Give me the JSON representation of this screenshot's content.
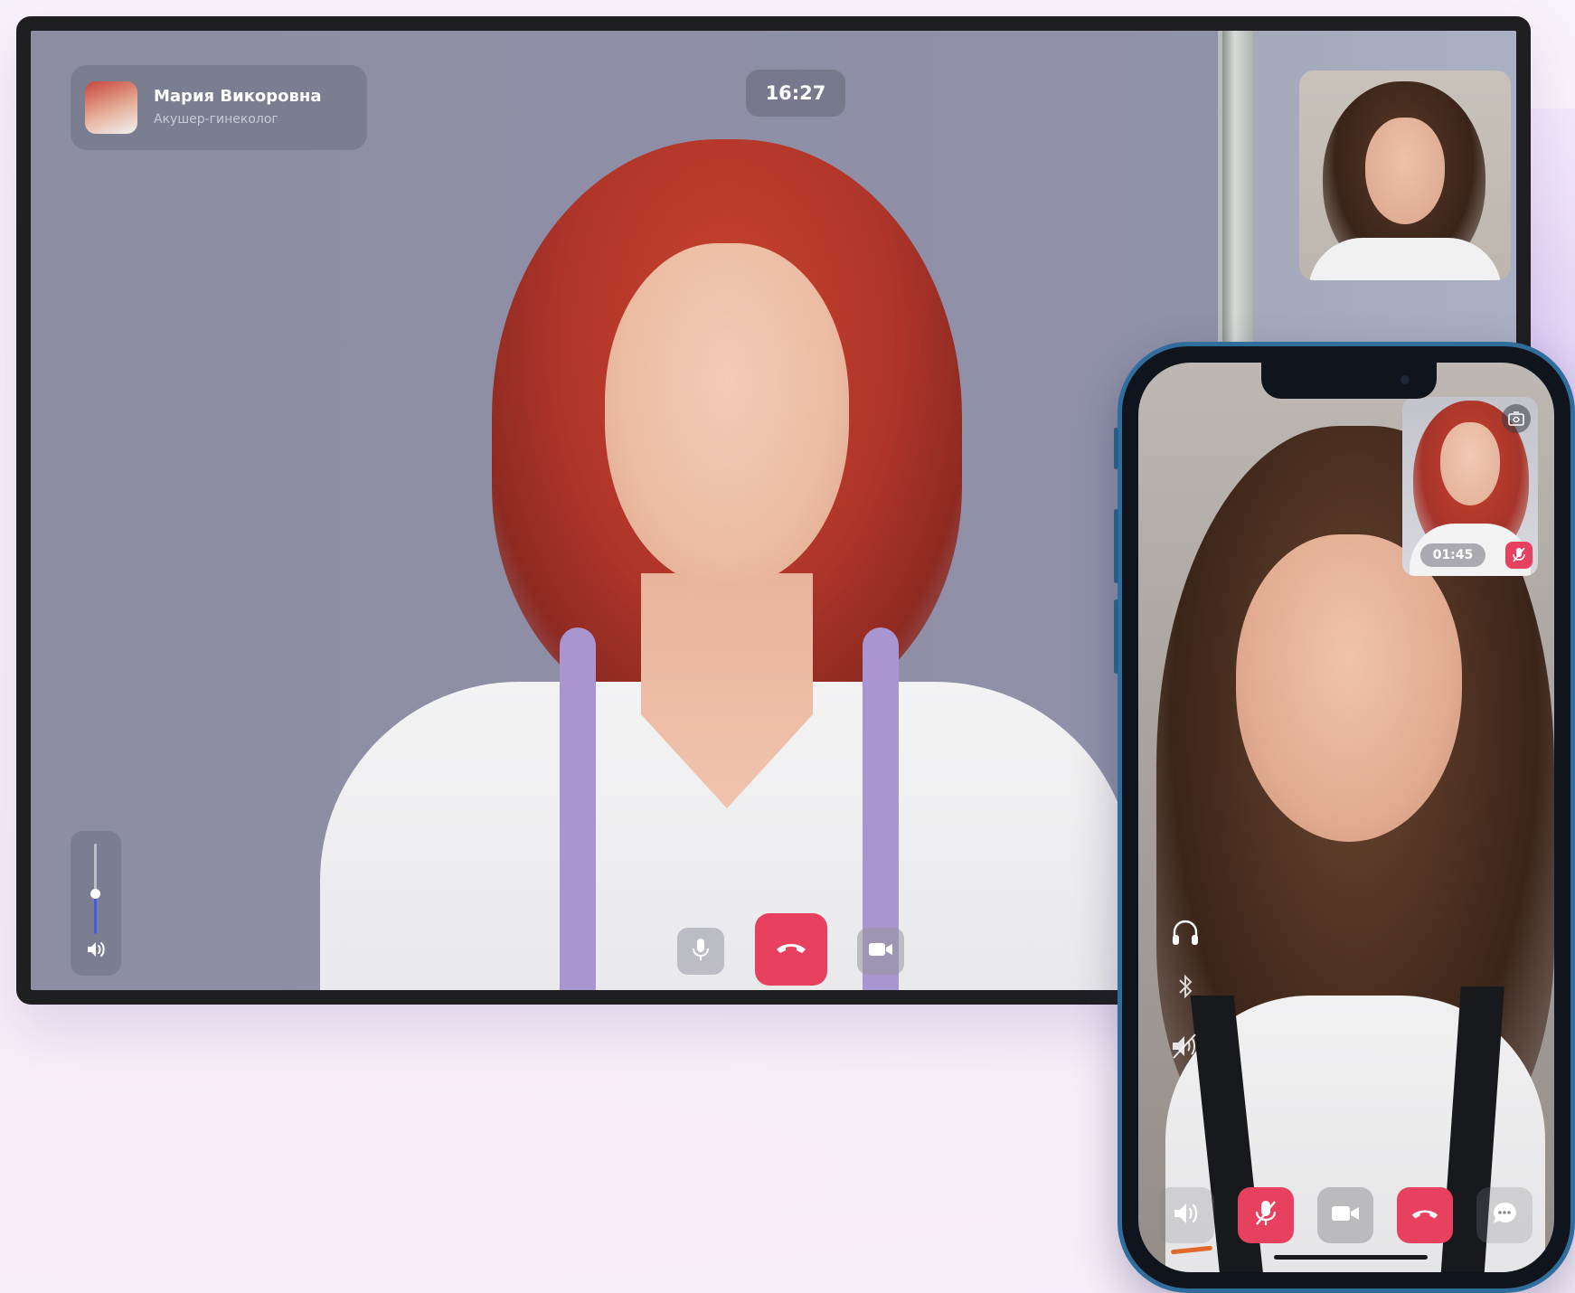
{
  "desktop": {
    "caller": {
      "name": "Мария Викоровна",
      "role": "Акушер-гинеколог"
    },
    "call_time": "16:27",
    "volume_level": 0.45,
    "controls": {
      "mic_icon": "microphone-icon",
      "end_call_icon": "phone-hangup-icon",
      "camera_icon": "video-camera-icon"
    }
  },
  "phone": {
    "pip_timer": "01:45",
    "pip_icons": {
      "flip": "camera-flip-icon",
      "muted": "mic-off-icon"
    },
    "side_icons": [
      "headphones-icon",
      "bluetooth-icon",
      "speaker-off-icon"
    ],
    "controls": [
      "speaker-icon",
      "mic-off-icon",
      "video-camera-icon",
      "phone-hangup-icon",
      "chat-icon"
    ]
  },
  "colors": {
    "end_call": "#e8415f",
    "volume_fill": "#3f5bf0",
    "phone_frame": "#2f6e9c"
  }
}
